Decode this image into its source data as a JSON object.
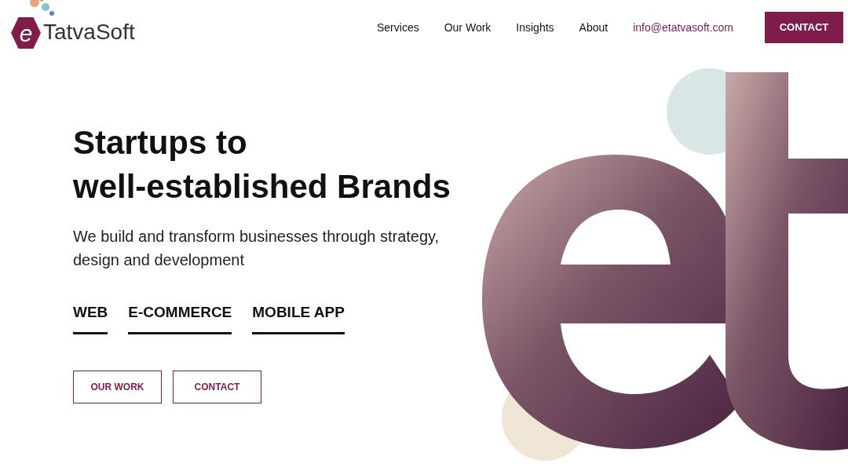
{
  "logo": {
    "mark": "e",
    "name": "TatvaSoft"
  },
  "nav": {
    "links": [
      "Services",
      "Our Work",
      "Insights",
      "About"
    ],
    "email": "info@etatvasoft.com",
    "button": "CONTACT"
  },
  "hero": {
    "title_lines": [
      "Startups to",
      "well-established Brands"
    ],
    "subtitle": "We build and transform businesses through strategy, design and development",
    "categories": [
      "WEB",
      "E-COMMERCE",
      "MOBILE APP"
    ],
    "buttons": [
      "OUR WORK",
      "CONTACT"
    ]
  }
}
